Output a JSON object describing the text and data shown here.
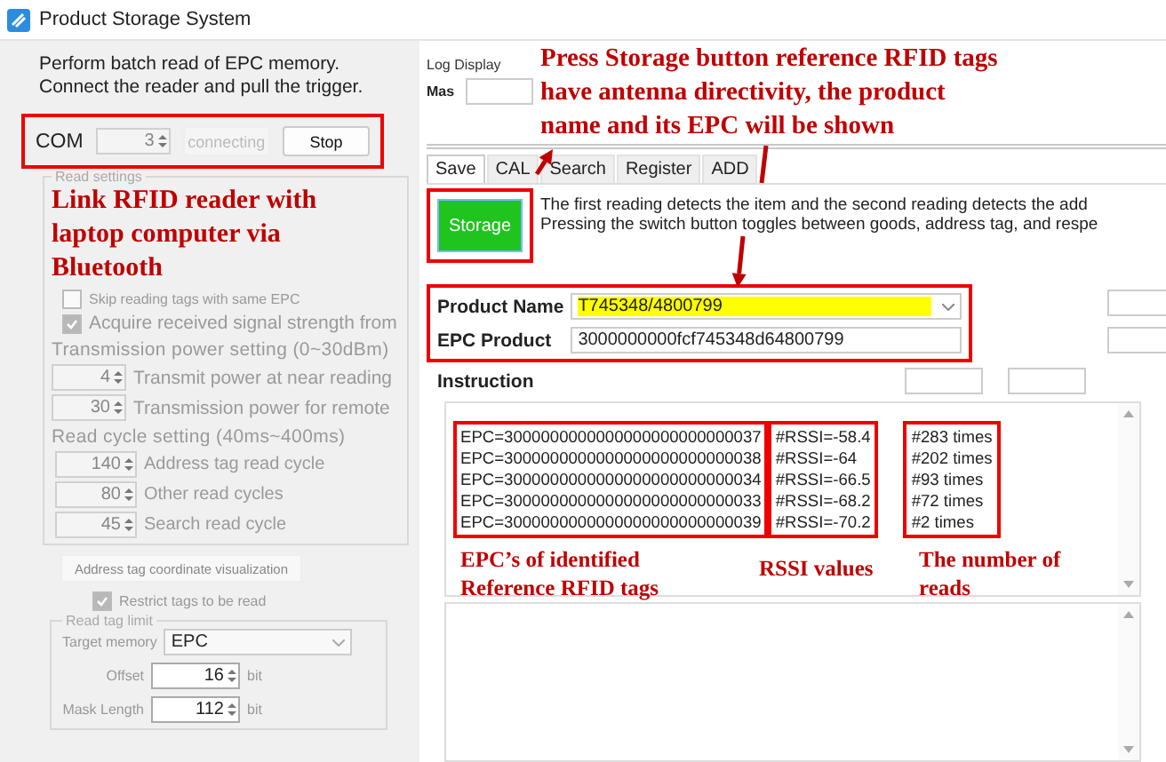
{
  "window": {
    "title": "Product Storage System"
  },
  "intro": [
    "Perform batch read of EPC memory.",
    "Connect the reader and pull the trigger."
  ],
  "com": {
    "label": "COM",
    "value": "3",
    "status_button": {
      "label": "connecting",
      "disabled": true
    },
    "stop_button": {
      "label": "Stop",
      "disabled": false
    }
  },
  "read_settings": {
    "title": "Read settings",
    "disabled": true,
    "checkboxes": [
      {
        "label": "Skip reading tags with same EPC",
        "checked": false
      },
      {
        "label": "Acquire received signal strength from",
        "checked": true
      }
    ],
    "power": {
      "heading": "Transmission power setting (0~30dBm)",
      "rows": [
        {
          "value": "4",
          "label": "Transmit power at near reading"
        },
        {
          "value": "30",
          "label": "Transmission power for remote"
        }
      ]
    },
    "cycle": {
      "heading": "Read cycle setting (40ms~400ms)",
      "rows": [
        {
          "value": "140",
          "label": "Address tag read cycle"
        },
        {
          "value": "80",
          "label": "Other read cycles"
        },
        {
          "value": "45",
          "label": "Search read cycle"
        }
      ]
    }
  },
  "visualize_button": "Address tag coordinate visualization",
  "restrict": {
    "label": "Restrict tags to be read",
    "checked": true
  },
  "read_tag_limit": {
    "title": "Read tag limit",
    "target_memory": {
      "label": "Target memory",
      "value": "EPC"
    },
    "offset": {
      "label": "Offset",
      "value": "16",
      "unit": "bit"
    },
    "mask_length": {
      "label": "Mask Length",
      "value": "112",
      "unit": "bit"
    }
  },
  "log_display": {
    "title": "Log Display",
    "label": "Mas"
  },
  "tabs": [
    {
      "label": "Save",
      "selected": true
    },
    {
      "label": "CAL",
      "selected": false
    },
    {
      "label": "Search",
      "selected": false
    },
    {
      "label": "Register",
      "selected": false
    },
    {
      "label": "ADD",
      "selected": false
    }
  ],
  "storage_button": "Storage",
  "description": [
    "The first reading detects the item and the second reading detects the add",
    "Pressing the switch button toggles between goods, address tag, and respe"
  ],
  "product_name": {
    "label": "Product Name",
    "value": "T745348/4800799"
  },
  "epc_product": {
    "label": "EPC Product",
    "value": "3000000000fcf745348d64800799"
  },
  "instruction_label": "Instruction",
  "results": [
    {
      "epc": "EPC=3000000000000000000000000037",
      "rssi": "#RSSI=-58.4",
      "reads": "#283 times"
    },
    {
      "epc": "EPC=3000000000000000000000000038",
      "rssi": "#RSSI=-64",
      "reads": "#202 times"
    },
    {
      "epc": "EPC=3000000000000000000000000034",
      "rssi": "#RSSI=-66.5",
      "reads": "#93 times"
    },
    {
      "epc": "EPC=3000000000000000000000000033",
      "rssi": "#RSSI=-68.2",
      "reads": "#72 times"
    },
    {
      "epc": "EPC=3000000000000000000000000039",
      "rssi": "#RSSI=-70.2",
      "reads": "#2 times"
    }
  ],
  "annotations": {
    "com": [
      "Link RFID reader with",
      "laptop computer via",
      "Bluetooth"
    ],
    "storage": [
      "Press Storage button reference RFID tags",
      "have antenna directivity, the product",
      "name and its EPC will be shown"
    ],
    "epc": [
      "EPC’s of identified",
      "Reference RFID tags"
    ],
    "rssi": [
      "RSSI values"
    ],
    "reads": [
      "The number of",
      "reads"
    ]
  }
}
